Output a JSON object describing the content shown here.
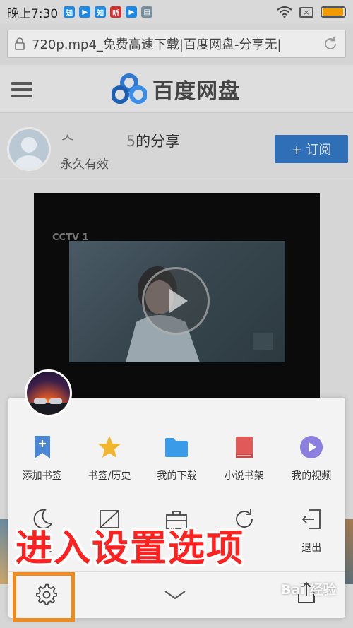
{
  "status_bar": {
    "time": "晚上7:30",
    "apps": [
      {
        "name": "zhihu-icon",
        "glyph": "知",
        "color": "#1e88e5"
      },
      {
        "name": "video-icon",
        "glyph": "▶",
        "color": "#1e88e5"
      },
      {
        "name": "zhihu-icon",
        "glyph": "知",
        "color": "#1e88e5"
      },
      {
        "name": "ting-icon",
        "glyph": "听",
        "color": "#d32f2f"
      },
      {
        "name": "video-icon",
        "glyph": "▶",
        "color": "#1e88e5"
      },
      {
        "name": "message-icon",
        "glyph": "▤",
        "color": "#78909c"
      }
    ],
    "battery_level": 0.95
  },
  "url_bar": {
    "url": "720p.mp4_免费高速下载|百度网盘-分享无|"
  },
  "header": {
    "logo_text": "百度网盘"
  },
  "share": {
    "title": "\u0000  \u0000\u0000\u0000 \u0000\u0000 的分享",
    "title_visible": "的分享",
    "subtitle": "永久有效",
    "subscribe_label": "+ 订阅"
  },
  "video": {
    "channel": "CCTV 1"
  },
  "menu": {
    "row1": [
      {
        "label": "添加书签",
        "icon": "bookmark-add-icon",
        "color": "#4a86d6"
      },
      {
        "label": "书签/历史",
        "icon": "star-icon",
        "color": "#f2b530"
      },
      {
        "label": "我的下载",
        "icon": "folder-icon",
        "color": "#3a9be8"
      },
      {
        "label": "小说书架",
        "icon": "book-icon",
        "color": "#e05a5a"
      },
      {
        "label": "我的视频",
        "icon": "video-play-icon",
        "color": "#8c7fe0"
      }
    ],
    "row2": [
      {
        "label": "模式",
        "icon": "night-mode-icon"
      },
      {
        "label": "智",
        "icon": "no-image-icon"
      },
      {
        "label": "具",
        "icon": "toolbox-icon"
      },
      {
        "label": "",
        "icon": "refresh-icon"
      },
      {
        "label": "退出",
        "icon": "exit-icon"
      }
    ]
  },
  "overlay": {
    "text": "进入设置选项"
  },
  "watermark": {
    "text": "Bai 经验"
  }
}
